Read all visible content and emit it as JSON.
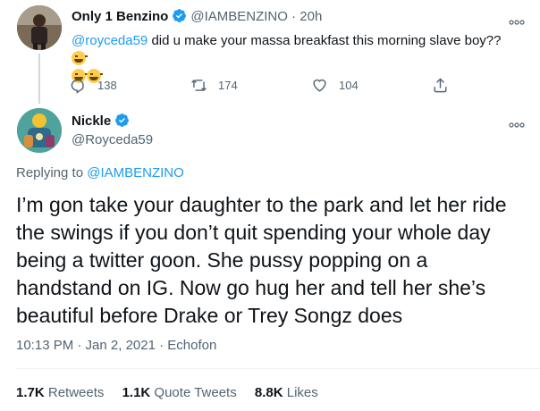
{
  "tweet1": {
    "name": "Only 1 Benzino",
    "handle": "@IAMBENZINO",
    "time": "· 20h",
    "mention": "@royceda59",
    "text": " did u make your massa breakfast this morning slave boy?? ",
    "replies": "138",
    "retweets": "174",
    "likes": "104"
  },
  "tweet2": {
    "name": "Nickle",
    "handle": "@Royceda59",
    "replying_label": "Replying to ",
    "replying_to": "@IAMBENZINO",
    "text_lines": [
      "I’m gon take your daughter to the park and let her ride",
      "the swings if you don’t quit spending your whole day",
      "being a twitter goon. She pussy popping on a",
      "handstand on IG. Now go hug her and tell her she’s",
      "beautiful before Drake or Trey Songz does"
    ],
    "timestamp": "10:13 PM · Jan 2, 2021 · Echofon",
    "retweets_count": "1.7K",
    "retweets_label": "Retweets",
    "quote_count": "1.1K",
    "quote_label": "Quote Tweets",
    "likes_count": "8.8K",
    "likes_label": "Likes"
  },
  "colors": {
    "verified": "#1d9bf0",
    "link": "#1d9bf0",
    "secondary": "#536471"
  }
}
